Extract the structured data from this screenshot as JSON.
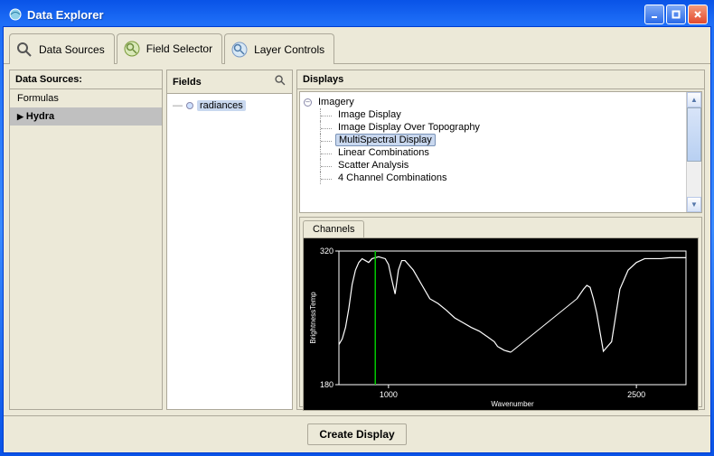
{
  "window": {
    "title": "Data Explorer"
  },
  "tabs": {
    "data_sources": "Data Sources",
    "field_selector": "Field Selector",
    "layer_controls": "Layer Controls",
    "active_index": 1
  },
  "sources": {
    "header": "Data Sources:",
    "items": [
      {
        "label": "Formulas",
        "selected": false
      },
      {
        "label": "Hydra",
        "selected": true
      }
    ]
  },
  "fields": {
    "header": "Fields",
    "items": [
      {
        "label": "radiances",
        "selected": true
      }
    ]
  },
  "displays": {
    "header": "Displays",
    "root": "Imagery",
    "items": [
      "Image Display",
      "Image Display Over Topography",
      "MultiSpectral Display",
      "Linear Combinations",
      "Scatter Analysis",
      "4 Channel Combinations"
    ],
    "selected_index": 2
  },
  "channels": {
    "tab_label": "Channels"
  },
  "chart_data": {
    "type": "line",
    "title": "",
    "xlabel": "Wavenumber",
    "ylabel": "BrightnessTemp",
    "xlim": [
      700,
      2800
    ],
    "ylim": [
      180,
      320
    ],
    "xticks": [
      1000,
      2500
    ],
    "yticks": [
      180,
      320
    ],
    "marker_x": 920,
    "series": [
      {
        "name": "spectrum",
        "x": [
          700,
          720,
          740,
          760,
          780,
          800,
          820,
          840,
          860,
          880,
          900,
          920,
          940,
          960,
          980,
          1000,
          1020,
          1040,
          1060,
          1080,
          1100,
          1150,
          1200,
          1250,
          1300,
          1350,
          1400,
          1450,
          1500,
          1550,
          1600,
          1640,
          1660,
          1680,
          1700,
          1720,
          1740,
          2140,
          2160,
          2180,
          2200,
          2220,
          2240,
          2260,
          2300,
          2350,
          2400,
          2450,
          2500,
          2550,
          2600,
          2650,
          2700,
          2750,
          2800
        ],
        "y": [
          222,
          228,
          240,
          260,
          285,
          300,
          308,
          312,
          310,
          308,
          312,
          313,
          314,
          313,
          312,
          306,
          290,
          275,
          300,
          310,
          310,
          300,
          285,
          270,
          265,
          258,
          250,
          245,
          240,
          236,
          230,
          225,
          220,
          218,
          216,
          215,
          214,
          270,
          275,
          280,
          284,
          282,
          270,
          255,
          215,
          225,
          280,
          300,
          308,
          312,
          312,
          312,
          313,
          313,
          313
        ]
      }
    ]
  },
  "footer": {
    "create_label": "Create Display"
  },
  "colors": {
    "spectrum_line": "#ffffff",
    "marker_line": "#00c800",
    "axis": "#ffffff",
    "chart_bg": "#000000"
  }
}
